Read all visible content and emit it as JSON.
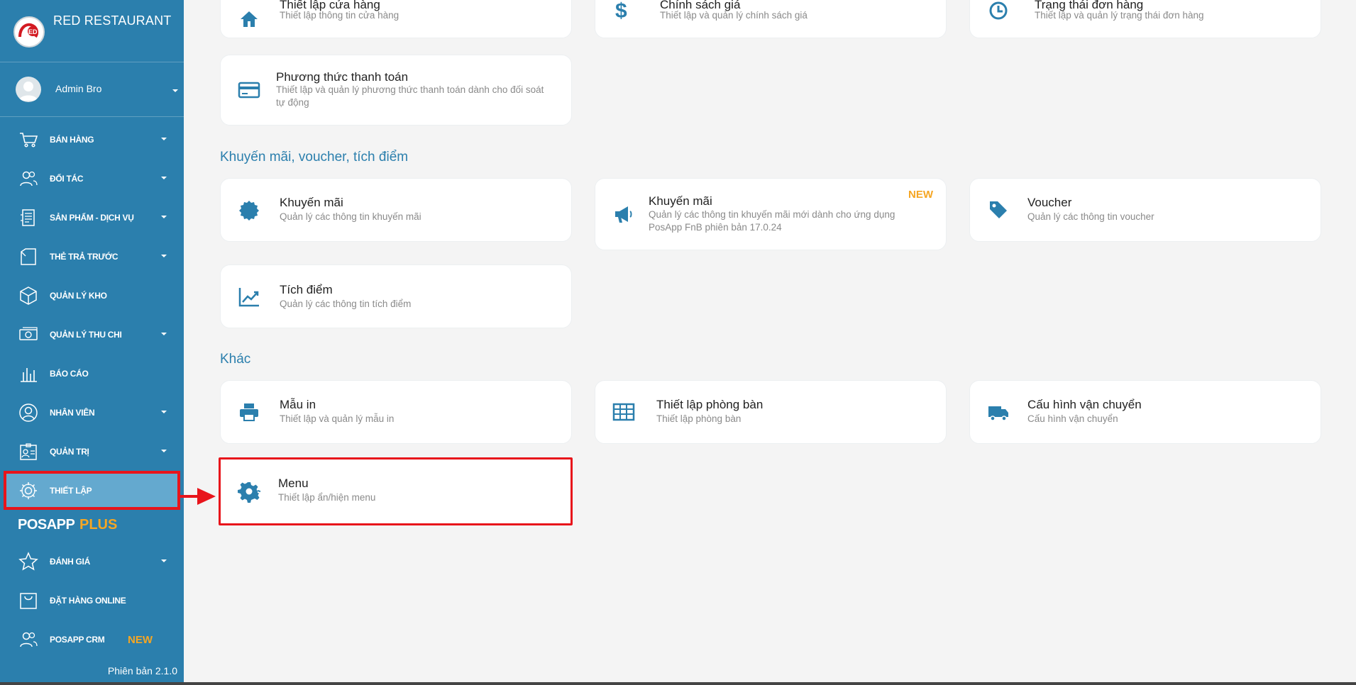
{
  "brand": {
    "name": "RED RESTAURANT"
  },
  "user": {
    "name": "Admin Bro"
  },
  "sidebar": {
    "items": [
      {
        "label": "BÁN HÀNG"
      },
      {
        "label": "ĐỐI TÁC"
      },
      {
        "label": "SẢN PHẨM - DỊCH VỤ"
      },
      {
        "label": "THẺ TRẢ TRƯỚC"
      },
      {
        "label": "QUẢN LÝ KHO"
      },
      {
        "label": "QUẢN LÝ THU CHI"
      },
      {
        "label": "BÁO CÁO"
      },
      {
        "label": "NHÂN VIÊN"
      },
      {
        "label": "QUẢN TRỊ"
      },
      {
        "label": "THIẾT LẬP"
      }
    ],
    "plus_a": "POSAPP",
    "plus_b": "PLUS",
    "plus_items": [
      {
        "label": "ĐÁNH GIÁ"
      },
      {
        "label": "ĐẶT HÀNG ONLINE"
      },
      {
        "label": "POSAPP CRM",
        "badge": "NEW"
      }
    ],
    "version": "Phiên bản 2.1.0"
  },
  "top_cards": [
    {
      "title": "Thiết lập cửa hàng",
      "sub": "Thiết lập thông tin cửa hàng"
    },
    {
      "title": "Chính sách giá",
      "sub": "Thiết lập và quản lý chính sách giá"
    },
    {
      "title": "Trạng thái đơn hàng",
      "sub": "Thiết lập và quản lý trạng thái đơn hàng"
    }
  ],
  "payment": {
    "title": "Phương thức thanh toán",
    "sub1": "Thiết lập và quản lý phương thức thanh toán dành cho đối soát",
    "sub2": "tự động"
  },
  "sections": {
    "promo": "Khuyến mãi, voucher, tích điểm",
    "other": "Khác"
  },
  "promo_cards": [
    {
      "title": "Khuyến mãi",
      "sub": "Quản lý các thông tin khuyến mãi"
    },
    {
      "title": "Khuyến mãi",
      "sub1": "Quản lý các thông tin khuyến mãi mới dành cho ứng dụng",
      "sub2": "PosApp FnB phiên bản 17.0.24",
      "badge": "NEW"
    },
    {
      "title": "Voucher",
      "sub": "Quản lý các thông tin voucher"
    },
    {
      "title": "Tích điểm",
      "sub": "Quản lý các thông tin tích điểm"
    }
  ],
  "other_cards": [
    {
      "title": "Mẫu in",
      "sub": "Thiết lập và quản lý mẫu in"
    },
    {
      "title": "Thiết lập phòng bàn",
      "sub": "Thiết lập phòng bàn"
    },
    {
      "title": "Cấu hình vận chuyển",
      "sub": "Cấu hình vận chuyển"
    },
    {
      "title": "Menu",
      "sub": "Thiết lập ẩn/hiện menu"
    }
  ],
  "colors": {
    "sidebar": "#2b7fad",
    "active": "#64a9cf",
    "accent": "#f5a623",
    "highlight": "#e8141b"
  }
}
